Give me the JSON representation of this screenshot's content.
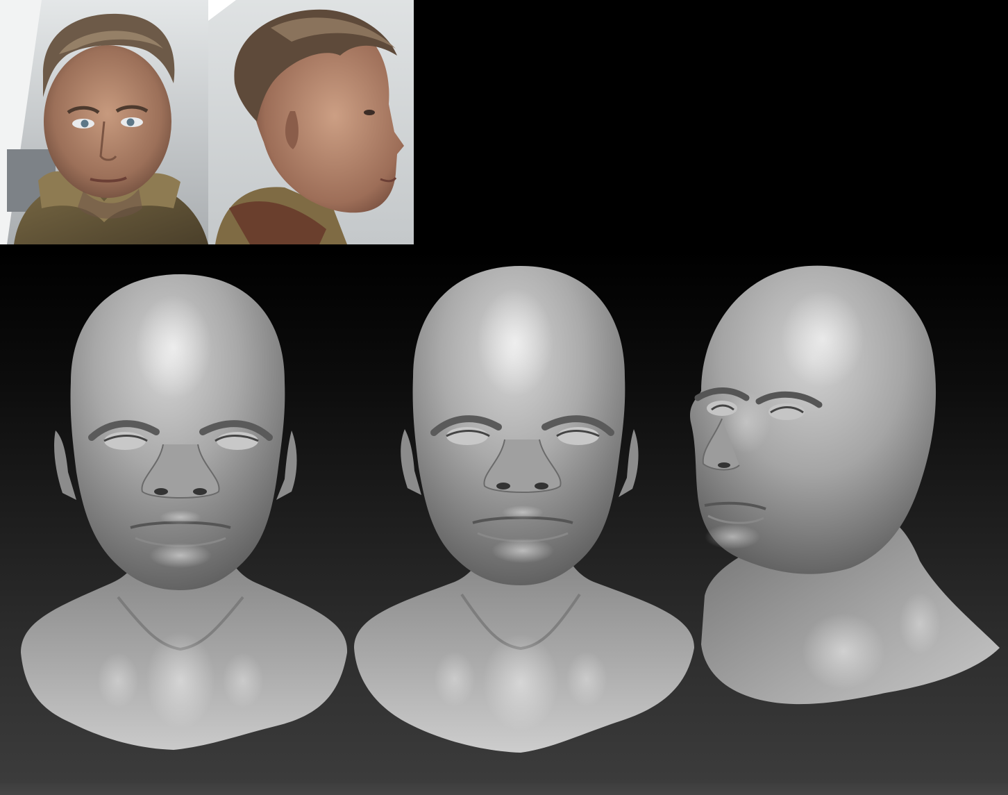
{
  "reference_photos": [
    {
      "name": "front-reference-photo"
    },
    {
      "name": "profile-reference-photo"
    }
  ],
  "sculpt_views": [
    {
      "name": "front-view-sculpt"
    },
    {
      "name": "front-view-sculpt-alt"
    },
    {
      "name": "three-quarter-view-sculpt"
    }
  ],
  "colors": {
    "background_top": "#000000",
    "background_bottom": "#3d3d3d",
    "sculpt_clay": "#a6a6a6"
  }
}
